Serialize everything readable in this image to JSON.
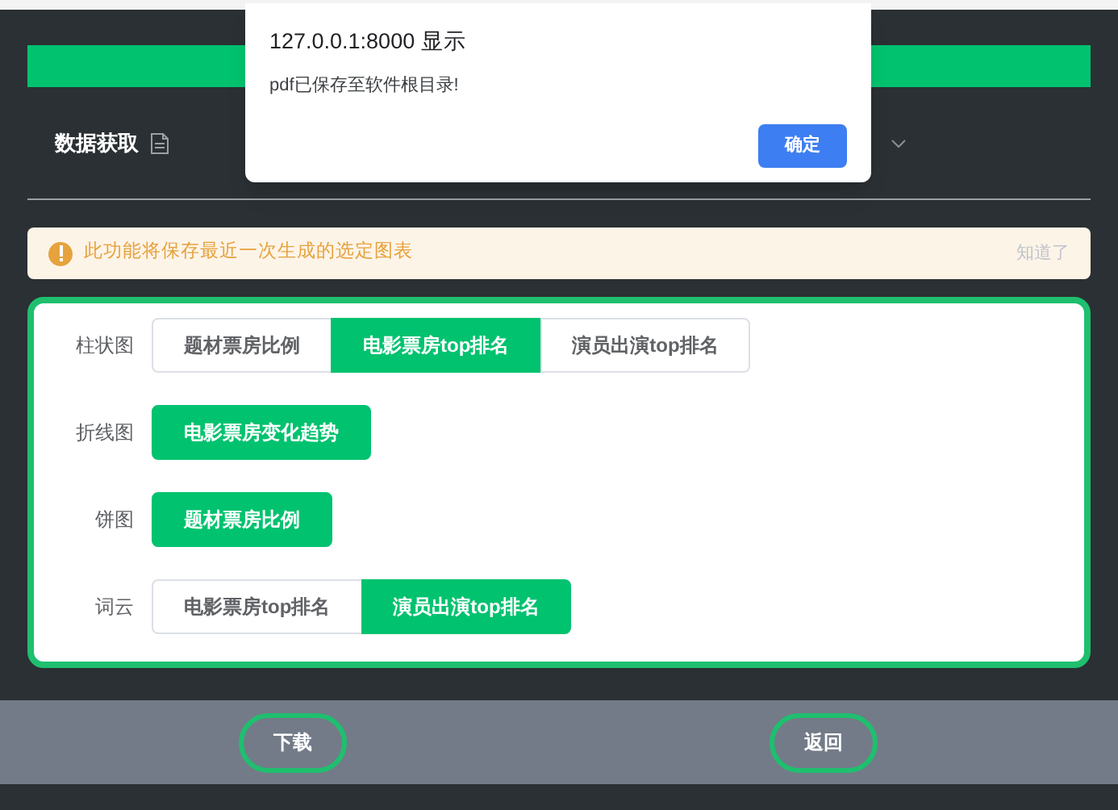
{
  "nav": {
    "items": [
      {
        "label": "数据获取",
        "kind": "doc"
      }
    ],
    "dropdown": true
  },
  "alert": {
    "message": "此功能将保存最近一次生成的选定图表",
    "dismiss": "知道了"
  },
  "groups": [
    {
      "label": "柱状图",
      "options": [
        {
          "label": "题材票房比例",
          "selected": false
        },
        {
          "label": "电影票房top排名",
          "selected": true
        },
        {
          "label": "演员出演top排名",
          "selected": false
        }
      ]
    },
    {
      "label": "折线图",
      "options": [
        {
          "label": "电影票房变化趋势",
          "selected": true
        }
      ]
    },
    {
      "label": "饼图",
      "options": [
        {
          "label": "题材票房比例",
          "selected": true
        }
      ]
    },
    {
      "label": "词云",
      "options": [
        {
          "label": "电影票房top排名",
          "selected": false
        },
        {
          "label": "演员出演top排名",
          "selected": true
        }
      ]
    }
  ],
  "footer": {
    "buttons": [
      "下载",
      "返回"
    ]
  },
  "dialog": {
    "title": "127.0.0.1:8000 显示",
    "message": "pdf已保存至软件根目录!",
    "button": "确定"
  }
}
